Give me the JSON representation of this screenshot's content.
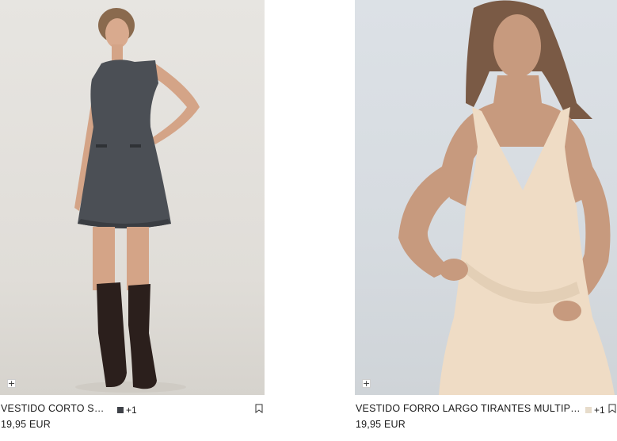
{
  "products": [
    {
      "name": "VESTIDO CORTO SOFT",
      "price": "19,95 EUR",
      "extra_colors": "+1",
      "swatch_color": "#3f4248",
      "add_icon": "plus-icon",
      "bookmark_icon": "bookmark-icon",
      "add_label": "+"
    },
    {
      "name": "VESTIDO FORRO LARGO TIRANTES MULTIPOSICIÓN",
      "price": "19,95 EUR",
      "extra_colors": "+1",
      "swatch_color": "#e7dccb",
      "add_icon": "plus-icon",
      "bookmark_icon": "bookmark-icon",
      "add_label": "+"
    }
  ]
}
